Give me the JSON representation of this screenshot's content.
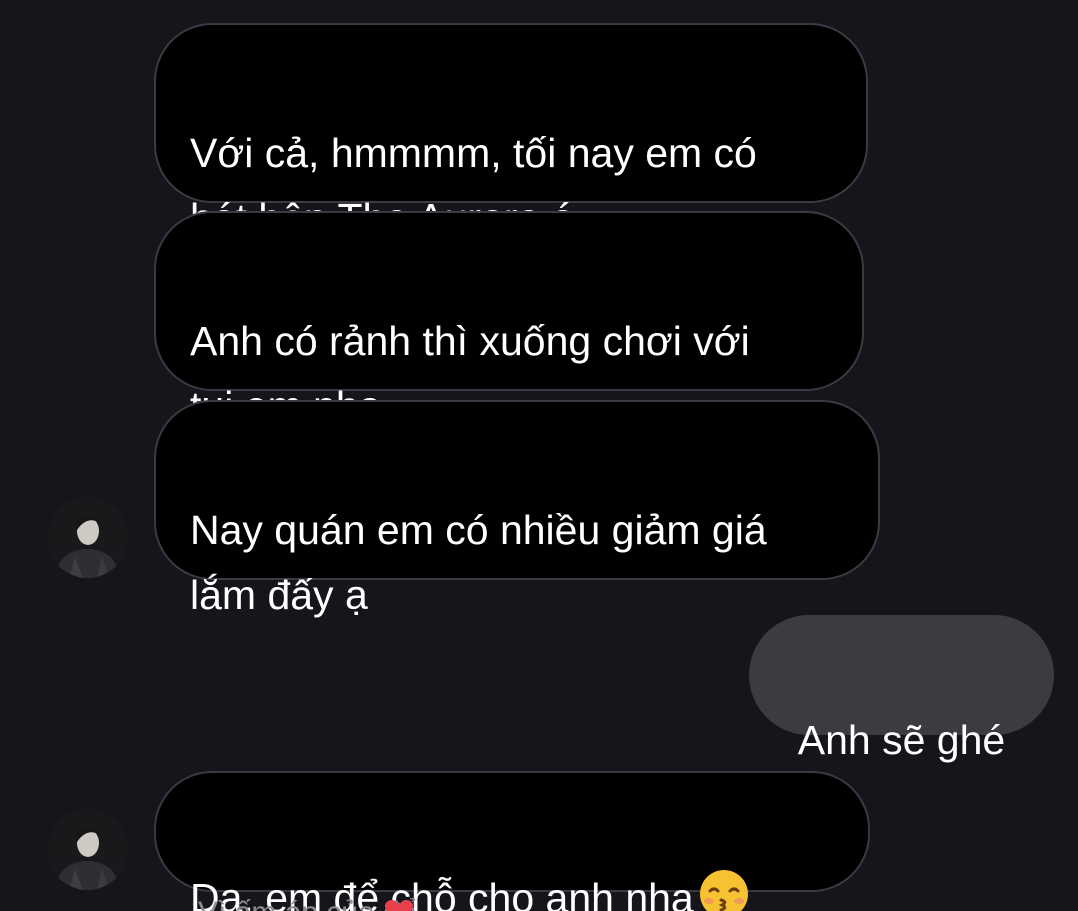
{
  "conversation": {
    "messages": [
      {
        "sender": "contact",
        "text": "Với cả, hmmmm, tối nay em có\nhát bên The Aurora á"
      },
      {
        "sender": "contact",
        "text": "Anh có rảnh thì xuống chơi với\ntụi em nha"
      },
      {
        "sender": "contact",
        "text": "Nay quán em có nhiều giảm giá\nlắm đấy ạ"
      },
      {
        "sender": "me",
        "text": "Anh sẽ ghé"
      },
      {
        "sender": "contact",
        "text": "Dạ, em để chỗ cho anh nha",
        "emoji": "kissing-face-with-closed-eyes-icon"
      }
    ],
    "cut_off_reply": "Vì ấm áp của để"
  },
  "colors": {
    "background": "#15161b",
    "incoming_bubble": "#000000",
    "incoming_border": "#3a3b42",
    "outgoing_bubble": "#3b3c42",
    "text": "#ffffff"
  }
}
